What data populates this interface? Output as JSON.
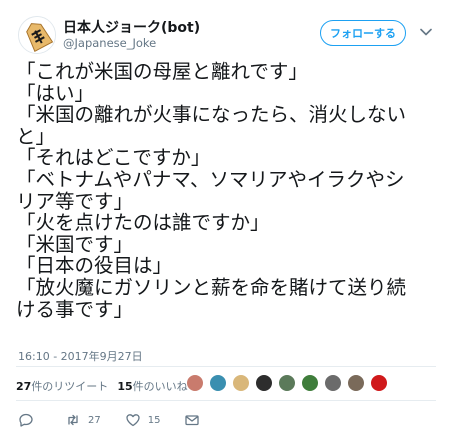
{
  "author": {
    "display_name": "日本人ジョーク(bot)",
    "handle": "@Japanese_Joke",
    "avatar_icon": "shogi-piece-icon"
  },
  "follow_button": "フォローする",
  "tweet_lines": [
    "「これが米国の母屋と離れです」",
    "「はい」",
    "「米国の離れが火事になったら、消火しない",
    "と」",
    "「それはどこですか」",
    "「ベトナムやパナマ、ソマリアやイラクやシ",
    "リア等です」",
    "「火を点けたのは誰ですか」",
    "「米国です」",
    "「日本の役目は」",
    "「放火魔にガソリンと薪を命を賭けて送り続",
    "ける事です」"
  ],
  "timestamp": "16:10 - 2017年9月27日",
  "stats": {
    "retweets_count": "27",
    "retweets_label": "件のリツイート",
    "likes_count": "15",
    "likes_label": "件のいいね"
  },
  "likers_colors": [
    "#c97b6d",
    "#3a8fb0",
    "#d9b77a",
    "#2d2d2d",
    "#5b7a5a",
    "#3f7d3b",
    "#6b6b6b",
    "#7a6a5a",
    "#d0191b"
  ],
  "actions": {
    "reply_count": "",
    "retweet_count": "27",
    "like_count": "15"
  },
  "colors": {
    "accent": "#1da1f2",
    "text": "#14171a",
    "muted": "#657786"
  }
}
